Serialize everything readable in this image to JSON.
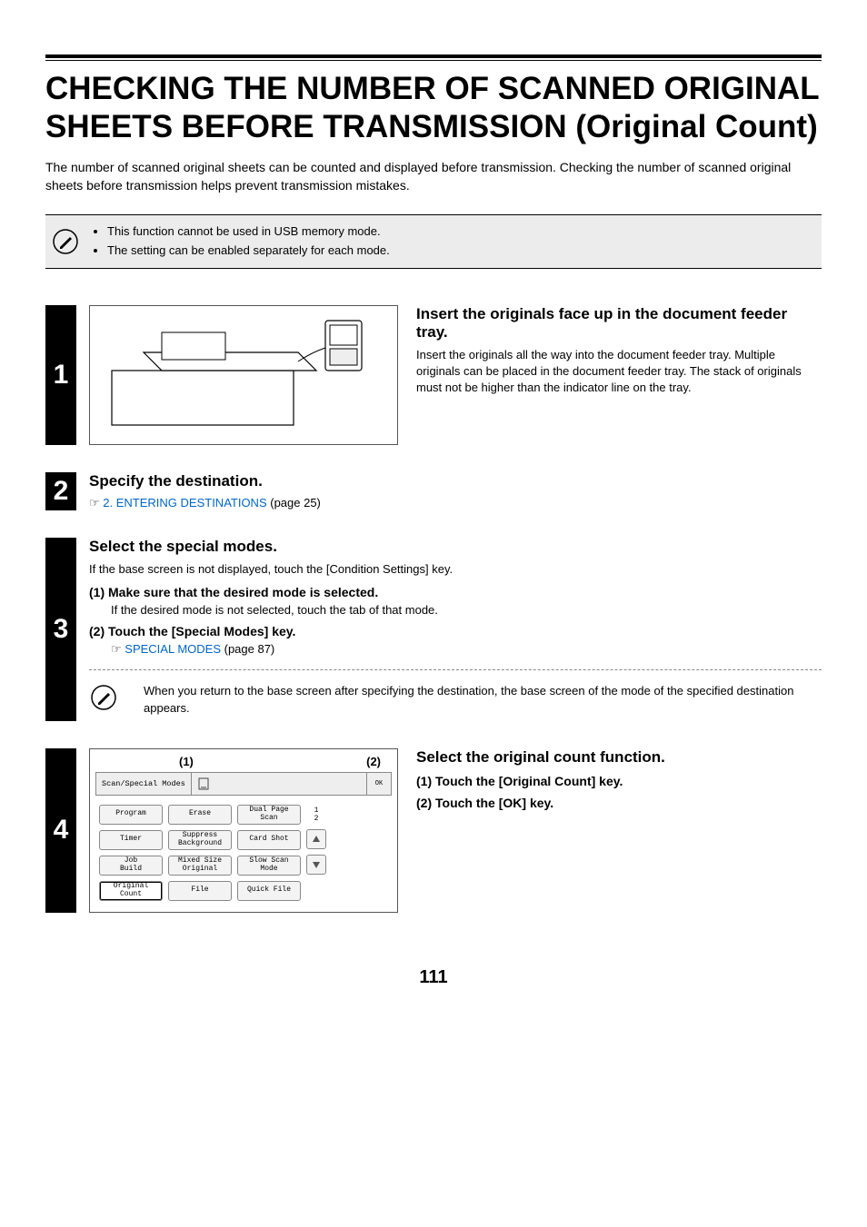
{
  "title": "CHECKING THE NUMBER OF SCANNED ORIGINAL SHEETS BEFORE TRANSMISSION (Original Count)",
  "intro": "The number of scanned original sheets can be counted and displayed before transmission. Checking the number of scanned original sheets before transmission helps prevent transmission mistakes.",
  "notes": {
    "item1": "This function cannot be used in USB memory mode.",
    "item2": "The setting can be enabled separately for each mode."
  },
  "step1": {
    "num": "1",
    "heading": "Insert the originals face up in the document feeder tray.",
    "text": "Insert the originals all the way into the document feeder tray. Multiple originals can be placed in the document feeder tray. The stack of originals must not be higher than the indicator line on the tray."
  },
  "step2": {
    "num": "2",
    "heading": "Specify the destination.",
    "ptr": "☞",
    "link": "2. ENTERING DESTINATIONS",
    "pageref": " (page 25)"
  },
  "step3": {
    "num": "3",
    "heading": "Select the special modes.",
    "text": "If the base screen is not displayed, touch the [Condition Settings] key.",
    "sub1_head": "(1)  Make sure that the desired mode is selected.",
    "sub1_text": "If the desired mode is not selected, touch the tab of that mode.",
    "sub2_head": "(2)  Touch the [Special Modes] key.",
    "ptr": "☞",
    "link": "SPECIAL MODES",
    "pageref": " (page 87)",
    "note": "When you return to the base screen after specifying the destination, the base screen of the mode of the specified destination appears."
  },
  "step4": {
    "num": "4",
    "callout1": "(1)",
    "callout2": "(2)",
    "heading": "Select the original count function.",
    "sub1": "(1)  Touch the [Original Count] key.",
    "sub2": "(2)  Touch the [OK] key.",
    "ui": {
      "tab": "Scan/Special Modes",
      "ok": "OK",
      "col1": {
        "b1": "Program",
        "b2": "Timer",
        "b3a": "Job",
        "b3b": "Build",
        "b4a": "Original",
        "b4b": "Count"
      },
      "col2": {
        "b1": "Erase",
        "b2a": "Suppress",
        "b2b": "Background",
        "b3a": "Mixed Size",
        "b3b": "Original",
        "b4": "File"
      },
      "col3": {
        "b1a": "Dual Page",
        "b1b": "Scan",
        "b2": "Card Shot",
        "b3a": "Slow Scan",
        "b3b": "Mode",
        "b4": "Quick File"
      },
      "page": "1\n2",
      "up": "✦",
      "down": "✦"
    }
  },
  "page_number": "111"
}
